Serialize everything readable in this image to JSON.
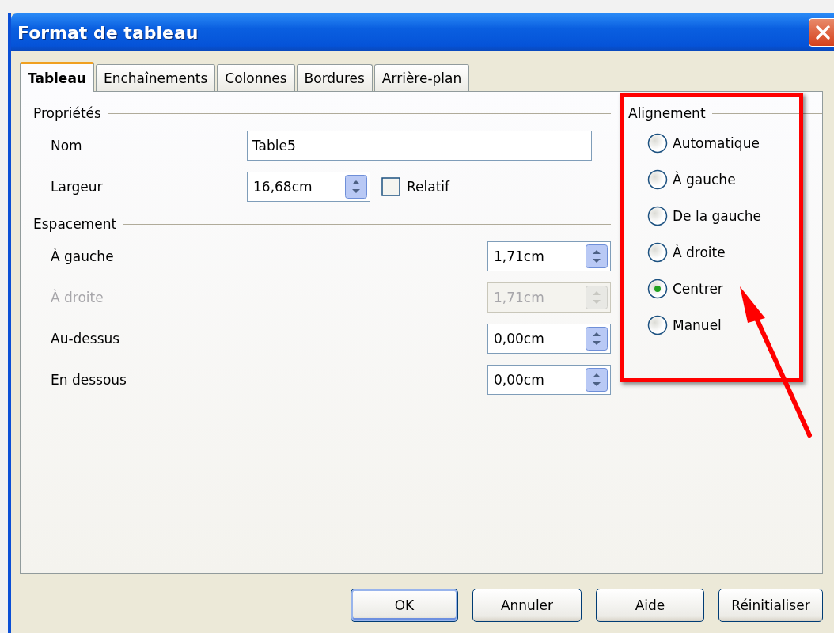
{
  "window": {
    "title": "Format de tableau"
  },
  "tabs": [
    {
      "label": "Tableau",
      "selected": true
    },
    {
      "label": "Enchaînements",
      "selected": false
    },
    {
      "label": "Colonnes",
      "selected": false
    },
    {
      "label": "Bordures",
      "selected": false
    },
    {
      "label": "Arrière-plan",
      "selected": false
    }
  ],
  "properties": {
    "heading": "Propriétés",
    "name_label": "Nom",
    "name_value": "Table5",
    "width_label": "Largeur",
    "width_value": "16,68cm",
    "relative": {
      "label": "Relatif",
      "checked": false
    }
  },
  "spacing": {
    "heading": "Espacement",
    "fields": [
      {
        "label": "À gauche",
        "value": "1,71cm",
        "disabled": false
      },
      {
        "label": "À droite",
        "value": "1,71cm",
        "disabled": true
      },
      {
        "label": "Au-dessus",
        "value": "0,00cm",
        "disabled": false
      },
      {
        "label": "En dessous",
        "value": "0,00cm",
        "disabled": false
      }
    ]
  },
  "alignment": {
    "heading": "Alignement",
    "options": [
      {
        "label": "Automatique",
        "selected": false
      },
      {
        "label": "À gauche",
        "selected": false
      },
      {
        "label": "De la gauche",
        "selected": false
      },
      {
        "label": "À droite",
        "selected": false
      },
      {
        "label": "Centrer",
        "selected": true
      },
      {
        "label": "Manuel",
        "selected": false
      }
    ]
  },
  "buttons": [
    {
      "label": "OK",
      "default": true
    },
    {
      "label": "Annuler",
      "default": false
    },
    {
      "label": "Aide",
      "default": false
    },
    {
      "label": "Réinitialiser",
      "default": false
    }
  ]
}
